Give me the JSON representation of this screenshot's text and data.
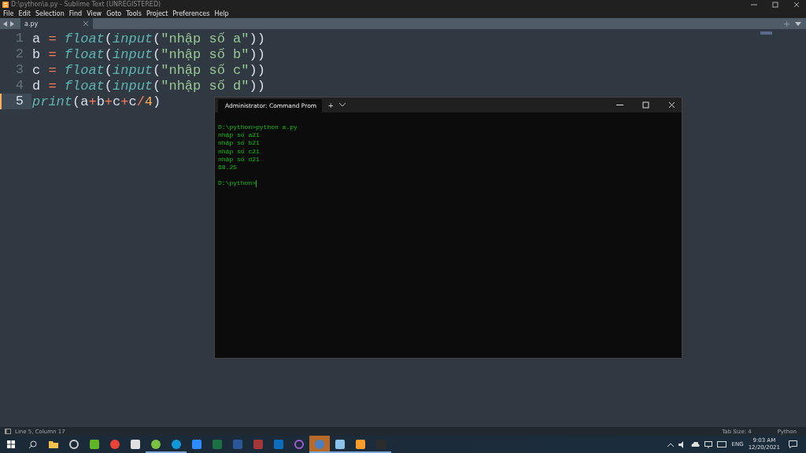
{
  "window": {
    "title": "D:\\python\\a.py - Sublime Text (UNREGISTERED)"
  },
  "menu": [
    "File",
    "Edit",
    "Selection",
    "Find",
    "View",
    "Goto",
    "Tools",
    "Project",
    "Preferences",
    "Help"
  ],
  "tabs": [
    {
      "label": "a.py",
      "selected": true
    }
  ],
  "code": [
    {
      "number": "1",
      "current": false,
      "tokens": [
        {
          "kind": "var",
          "text": "a "
        },
        {
          "kind": "op",
          "text": "="
        },
        {
          "kind": "func",
          "text": " float"
        },
        {
          "kind": "punct",
          "text": "("
        },
        {
          "kind": "func",
          "text": "input"
        },
        {
          "kind": "punct",
          "text": "("
        },
        {
          "kind": "string",
          "text": "\"nhập số a\""
        },
        {
          "kind": "punct",
          "text": "))"
        }
      ]
    },
    {
      "number": "2",
      "current": false,
      "tokens": [
        {
          "kind": "var",
          "text": "b "
        },
        {
          "kind": "op",
          "text": "="
        },
        {
          "kind": "func",
          "text": " float"
        },
        {
          "kind": "punct",
          "text": "("
        },
        {
          "kind": "func",
          "text": "input"
        },
        {
          "kind": "punct",
          "text": "("
        },
        {
          "kind": "string",
          "text": "\"nhập số b\""
        },
        {
          "kind": "punct",
          "text": "))"
        }
      ]
    },
    {
      "number": "3",
      "current": false,
      "tokens": [
        {
          "kind": "var",
          "text": "c "
        },
        {
          "kind": "op",
          "text": "="
        },
        {
          "kind": "func",
          "text": " float"
        },
        {
          "kind": "punct",
          "text": "("
        },
        {
          "kind": "func",
          "text": "input"
        },
        {
          "kind": "punct",
          "text": "("
        },
        {
          "kind": "string",
          "text": "\"nhập số c\""
        },
        {
          "kind": "punct",
          "text": "))"
        }
      ]
    },
    {
      "number": "4",
      "current": false,
      "tokens": [
        {
          "kind": "var",
          "text": "d "
        },
        {
          "kind": "op",
          "text": "="
        },
        {
          "kind": "func",
          "text": " float"
        },
        {
          "kind": "punct",
          "text": "("
        },
        {
          "kind": "func",
          "text": "input"
        },
        {
          "kind": "punct",
          "text": "("
        },
        {
          "kind": "string",
          "text": "\"nhập số d\""
        },
        {
          "kind": "punct",
          "text": "))"
        }
      ]
    },
    {
      "number": "5",
      "current": true,
      "tokens": [
        {
          "kind": "func",
          "text": "print"
        },
        {
          "kind": "punct",
          "text": "(a"
        },
        {
          "kind": "op",
          "text": "+"
        },
        {
          "kind": "punct",
          "text": "b"
        },
        {
          "kind": "op",
          "text": "+"
        },
        {
          "kind": "punct",
          "text": "c"
        },
        {
          "kind": "op",
          "text": "+"
        },
        {
          "kind": "punct",
          "text": "c"
        },
        {
          "kind": "op",
          "text": "/"
        },
        {
          "kind": "number",
          "text": "4"
        },
        {
          "kind": "punct",
          "text": ")"
        }
      ]
    }
  ],
  "terminal": {
    "tab_title": "Administrator: Command Prom",
    "new_tab": "+",
    "lines": [
      "D:\\python>python a.py",
      "nhập số a21",
      "nhập số b21",
      "nhập số c21",
      "nhập số d21",
      "68.25"
    ],
    "prompt": "D:\\python>"
  },
  "status_bar": {
    "position": "Line 5, Column 17",
    "tab_size": "Tab Size: 4",
    "syntax": "Python"
  },
  "taskbar": {
    "apps": [
      {
        "kind": "explorer",
        "running": false,
        "selected": false
      },
      {
        "kind": "obs",
        "running": false,
        "selected": false
      },
      {
        "kind": "camtasia",
        "running": false,
        "selected": false
      },
      {
        "kind": "chrome",
        "running": false,
        "selected": false
      },
      {
        "kind": "network",
        "running": false,
        "selected": false
      },
      {
        "kind": "greenapp",
        "running": true,
        "selected": false
      },
      {
        "kind": "skype",
        "running": true,
        "selected": false
      },
      {
        "kind": "zoom",
        "running": false,
        "selected": false
      },
      {
        "kind": "excel",
        "running": false,
        "selected": false
      },
      {
        "kind": "word",
        "running": false,
        "selected": false
      },
      {
        "kind": "access",
        "running": false,
        "selected": false
      },
      {
        "kind": "outlook",
        "running": false,
        "selected": false
      },
      {
        "kind": "github",
        "running": false,
        "selected": false
      },
      {
        "kind": "blender",
        "running": true,
        "selected": true
      },
      {
        "kind": "notepad",
        "running": true,
        "selected": false
      },
      {
        "kind": "sublime",
        "running": true,
        "selected": false
      },
      {
        "kind": "terminal",
        "running": true,
        "selected": false
      }
    ],
    "language": "ENG",
    "time": "9:03 AM",
    "date": "12/20/2021"
  }
}
